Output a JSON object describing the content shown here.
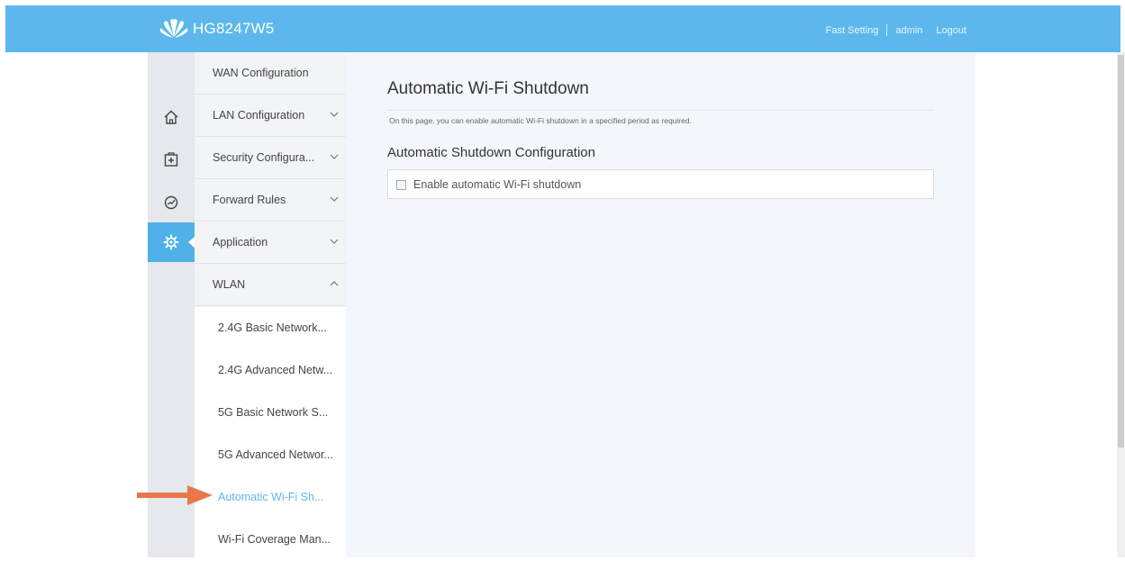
{
  "header": {
    "brand": "HG8247W5",
    "links": {
      "fast_setting": "Fast Setting",
      "user": "admin",
      "logout": "Logout"
    },
    "bg_color": "#5cb8ec"
  },
  "icon_rail": {
    "items": [
      {
        "icon": "home-icon",
        "active": false
      },
      {
        "icon": "add-box-icon",
        "active": false
      },
      {
        "icon": "gauge-icon",
        "active": false
      },
      {
        "icon": "gear-icon",
        "active": true
      }
    ],
    "active_color": "#4fb1e8"
  },
  "sidebar": {
    "items": [
      {
        "label": "WAN Configuration",
        "chevron": "none"
      },
      {
        "label": "LAN Configuration",
        "chevron": "down"
      },
      {
        "label": "Security Configura...",
        "chevron": "down"
      },
      {
        "label": "Forward Rules",
        "chevron": "down"
      },
      {
        "label": "Application",
        "chevron": "down"
      },
      {
        "label": "WLAN",
        "chevron": "up"
      }
    ],
    "wlan_subitems": [
      {
        "label": "2.4G Basic Network...",
        "active": false
      },
      {
        "label": "2.4G Advanced Netw...",
        "active": false
      },
      {
        "label": "5G Basic Network S...",
        "active": false
      },
      {
        "label": "5G Advanced Networ...",
        "active": false
      },
      {
        "label": "Automatic Wi-Fi Sh...",
        "active": true
      },
      {
        "label": "Wi-Fi Coverage Man...",
        "active": false
      }
    ]
  },
  "main": {
    "title": "Automatic Wi-Fi Shutdown",
    "description": "On this page, you can enable automatic Wi-Fi shutdown in a specified period as required.",
    "section_title": "Automatic Shutdown Configuration",
    "enable_checkbox": {
      "label": "Enable automatic Wi-Fi shutdown",
      "checked": false
    }
  },
  "annotation_arrow": {
    "color": "#e8784a"
  }
}
